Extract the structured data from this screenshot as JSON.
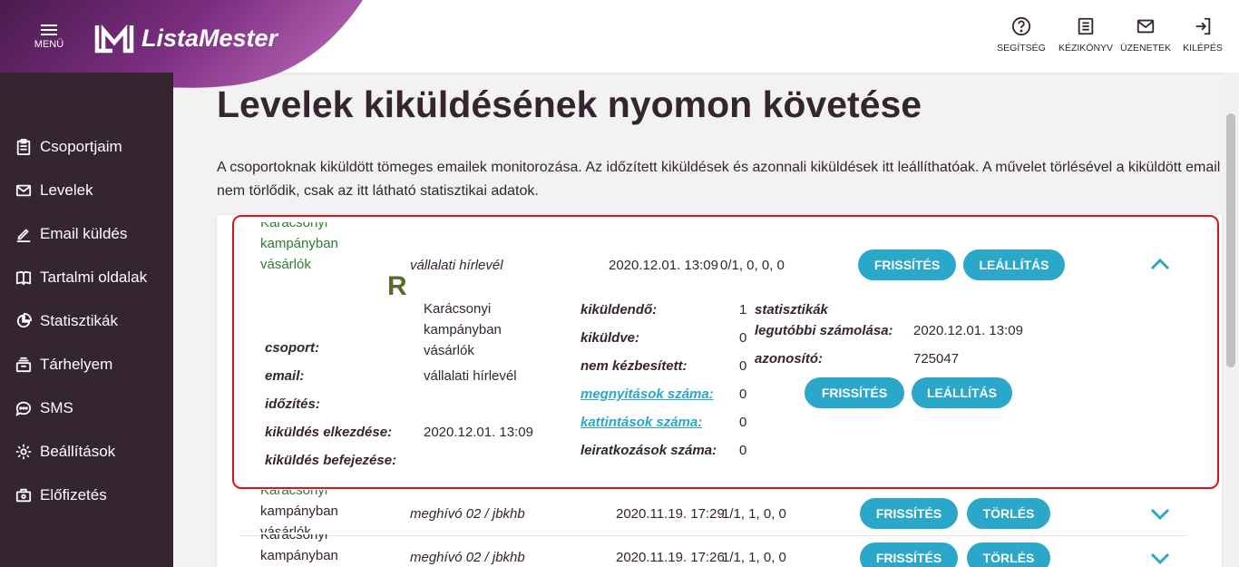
{
  "header": {
    "menu_label": "MENÜ",
    "logo_text": "ListaMester",
    "actions": [
      {
        "label": "SEGÍTSÉG",
        "icon": "help-circle-icon"
      },
      {
        "label": "KÉZIKÖNYV",
        "icon": "manual-icon"
      },
      {
        "label": "ÜZENETEK",
        "icon": "envelope-icon"
      },
      {
        "label": "KILÉPÉS",
        "icon": "logout-icon"
      }
    ]
  },
  "sidebar": {
    "items": [
      {
        "label": "Csoportjaim",
        "icon": "clipboard-icon"
      },
      {
        "label": "Levelek",
        "icon": "envelope-icon"
      },
      {
        "label": "Email küldés",
        "icon": "pen-icon"
      },
      {
        "label": "Tartalmi oldalak",
        "icon": "book-icon"
      },
      {
        "label": "Statisztikák",
        "icon": "pie-chart-icon"
      },
      {
        "label": "Tárhelyem",
        "icon": "storage-icon"
      },
      {
        "label": "SMS",
        "icon": "chat-icon"
      },
      {
        "label": "Beállítások",
        "icon": "gear-icon"
      },
      {
        "label": "Előfizetés",
        "icon": "subscription-icon"
      }
    ]
  },
  "main": {
    "title": "Levelek kiküldésének nyomon követése",
    "description": "A csoportoknak kiküldött tömeges emailek monitorozása. Az időzített kiküldések és azonnali kiküldések itt leállíthatóak. A művelet törlésével a kiküldött email nem törlődik, csak az itt látható statisztikai adatok."
  },
  "rows": [
    {
      "group_line1": "Karácsonyi",
      "group_line2": "kampányban",
      "group_line3": "vásárlók",
      "email": "vállalati hírlevél",
      "date": "2020.12.01. 13:09",
      "stats": "0/1, 0, 0, 0",
      "btn1": "FRISSÍTÉS",
      "btn2": "LEÁLLÍTÁS",
      "chevron": "chevron-up-icon"
    },
    {
      "group_line1": "Karácsonyi",
      "group_line2": "kampányban",
      "group_line3": "vásárlók",
      "email": "meghívó 02 / jbkhb",
      "date": "2020.11.19. 17:29",
      "stats": "1/1, 1, 0, 0",
      "btn1": "FRISSÍTÉS",
      "btn2": "TÖRLÉS",
      "chevron": "chevron-down-icon"
    },
    {
      "group_line1": "Karácsonyi",
      "group_line2": "kampányban",
      "email": "meghívó 02 / jbkhb",
      "date": "2020.11.19. 17:26",
      "stats": "1/1, 1, 0, 0",
      "btn1": "FRISSÍTÉS",
      "btn2": "TÖRLÉS",
      "chevron": "chevron-down-icon"
    }
  ],
  "detail": {
    "r_letter": "R",
    "group_value_line1": "Karácsonyi",
    "group_value_line2": "kampányban",
    "group_value_line3": "vásárlók",
    "labels": {
      "csoport": "csoport:",
      "email": "email:",
      "idozites": "időzítés:",
      "kezdes": "kiküldés elkezdése:",
      "befejezes": "kiküldés befejezése:"
    },
    "email_value": "vállalati hírlevél",
    "kezdes_value": "2020.12.01. 13:09",
    "counts": {
      "kikuldendo_label": "kiküldendő:",
      "kikuldendo": "1",
      "kikuldve_label": "kiküldve:",
      "kikuldve": "0",
      "nem_kezb_label": "nem kézbesített:",
      "nem_kezb": "0",
      "megnyitas_label": "megnyitások száma:",
      "megnyitas": "0",
      "kattintas_label": "kattintások száma:",
      "kattintas": "0",
      "leiratkozas_label": "leiratkozások száma:",
      "leiratkozas": "0"
    },
    "stats_title": "statisztikák",
    "last_calc_label": "legutóbbi számolása:",
    "last_calc_value": "2020.12.01. 13:09",
    "id_label": "azonosító:",
    "id_value": "725047",
    "btn1": "FRISSÍTÉS",
    "btn2": "LEÁLLÍTÁS"
  },
  "colors": {
    "accent": "#2aa7c9",
    "sidebar": "#34252f",
    "group_text": "#2e7d32",
    "highlight": "#e0131d"
  }
}
